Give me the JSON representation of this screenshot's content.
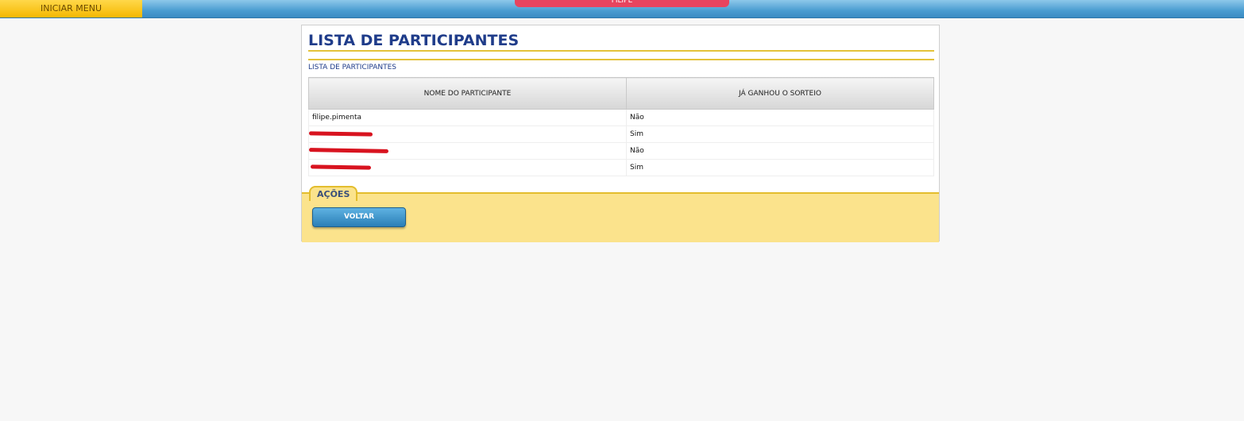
{
  "topbar": {
    "menu_label": "INICIAR MENU",
    "user_name": "FILIPE"
  },
  "panel": {
    "title": "LISTA DE PARTICIPANTES",
    "subtitle": "LISTA DE PARTICIPANTES",
    "table": {
      "headers": [
        "NOME DO PARTICIPANTE",
        "JÁ GANHOU O SORTEIO"
      ],
      "rows": [
        {
          "name": "filipe.pimenta",
          "won": "Não",
          "redacted": false
        },
        {
          "name": "",
          "won": "Sim",
          "redacted": true
        },
        {
          "name": "",
          "won": "Não",
          "redacted": true
        },
        {
          "name": "",
          "won": "Sim",
          "redacted": true
        }
      ]
    }
  },
  "actions": {
    "label": "AÇÕES",
    "back_button": "VOLTAR"
  },
  "colors": {
    "title": "#1f3c8a",
    "accent_yellow": "#e3bd2d",
    "redaction": "#d8131f"
  }
}
